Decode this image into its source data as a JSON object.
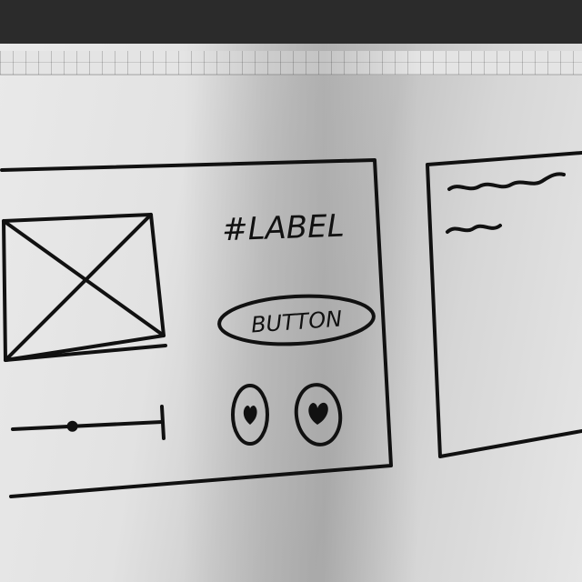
{
  "main_frame": {
    "label_text": "#LABEL",
    "button_label": "BUTTON",
    "slider": {
      "value": 0.4
    },
    "icons": [
      "heart-icon",
      "heart-icon"
    ]
  },
  "side_panel": {
    "content": "squiggle-text-placeholder"
  },
  "colors": {
    "ink": "#111111",
    "paper": "#e4e4e4"
  }
}
